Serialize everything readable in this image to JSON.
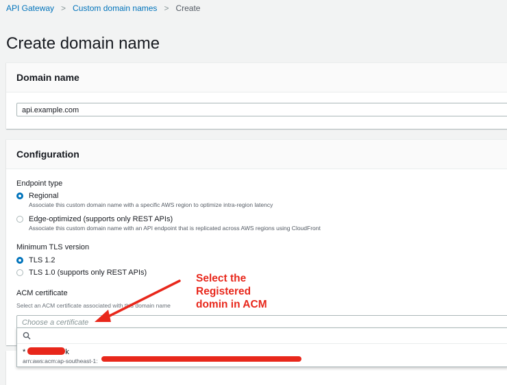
{
  "breadcrumb": {
    "items": [
      "API Gateway",
      "Custom domain names",
      "Create"
    ],
    "separator": ">"
  },
  "page": {
    "title": "Create domain name"
  },
  "domain_panel": {
    "header": "Domain name",
    "input_value": "api.example.com"
  },
  "config_panel": {
    "header": "Configuration",
    "endpoint_type": {
      "label": "Endpoint type",
      "options": [
        {
          "label": "Regional",
          "description": "Associate this custom domain name with a specific AWS region to optimize intra-region latency",
          "selected": true
        },
        {
          "label": "Edge-optimized (supports only REST APIs)",
          "description": "Associate this custom domain name with an API endpoint that is replicated across AWS regions using CloudFront",
          "selected": false
        }
      ]
    },
    "tls": {
      "label": "Minimum TLS version",
      "options": [
        {
          "label": "TLS 1.2",
          "selected": true
        },
        {
          "label": "TLS 1.0 (supports only REST APIs)",
          "selected": false
        }
      ]
    },
    "certificate": {
      "label": "ACM certificate",
      "helper": "Select an ACM certificate associated with this domain name",
      "placeholder": "Choose a certificate"
    }
  },
  "dropdown": {
    "option_name_prefix": "*",
    "option_name_suffix": "k",
    "option_arn_prefix": "arn:aws:acm:ap-southeast-1:"
  },
  "annotation": {
    "text_lines": [
      "Select the",
      "Registered",
      "domin in ACM"
    ],
    "color": "#e8271b"
  },
  "colors": {
    "link": "#0073bb",
    "radio_selected": "#0073bb",
    "background": "#f2f3f3"
  }
}
